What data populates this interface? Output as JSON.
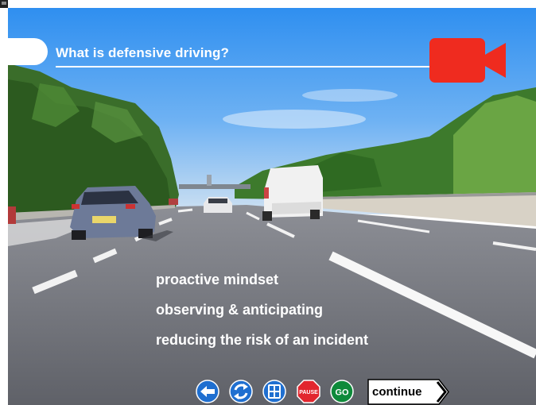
{
  "lesson": {
    "title": "What is defensive driving?",
    "points": [
      "proactive mindset",
      "observing & anticipating",
      "reducing the risk of an incident"
    ]
  },
  "controls": {
    "pause_label": "PAUSE",
    "go_label": "GO",
    "continue_label": "continue"
  },
  "colors": {
    "accent_red": "#ef2b1f",
    "nav_blue": "#1f6fd0",
    "go_green": "#0e8a3a",
    "stop_red": "#e2262e"
  },
  "icons": [
    "back-arrow-icon",
    "replay-icon",
    "menu-icon",
    "pause-icon",
    "go-icon",
    "video-camera-icon"
  ]
}
